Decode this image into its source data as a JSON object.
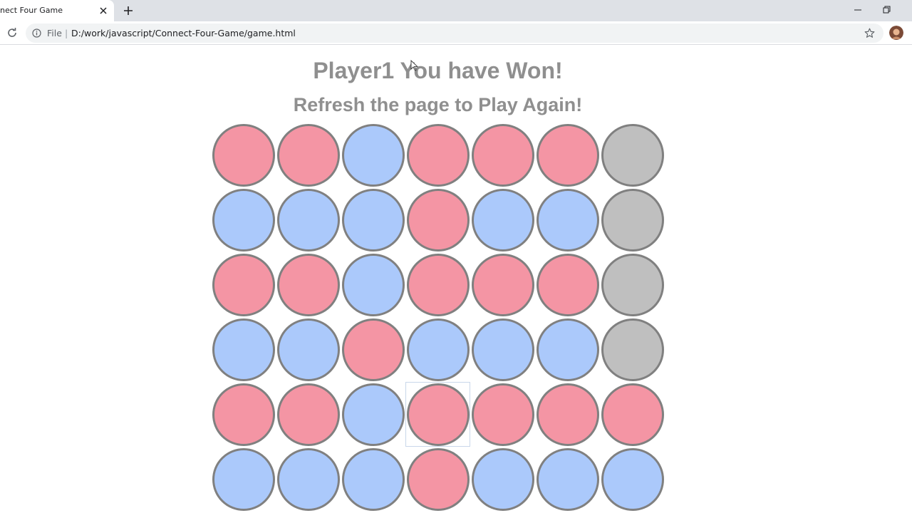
{
  "browser": {
    "tab_title": "nect Four Game",
    "address_scheme": "File",
    "address_separator": "|",
    "address_url": "D:/work/javascript/Connect-Four-Game/game.html"
  },
  "game": {
    "status_text": "Player1 You have Won!",
    "hint_text": "Refresh the page to Play Again!",
    "colors": {
      "player1": "#f495a4",
      "player2": "#abc9fb",
      "empty": "#bfbfbf",
      "border": "#808080"
    },
    "hovered_cell": {
      "row": 4,
      "col": 3
    },
    "board": [
      [
        "player1",
        "player1",
        "player2",
        "player1",
        "player1",
        "player1",
        "empty"
      ],
      [
        "player2",
        "player2",
        "player2",
        "player1",
        "player2",
        "player2",
        "empty"
      ],
      [
        "player1",
        "player1",
        "player2",
        "player1",
        "player1",
        "player1",
        "empty"
      ],
      [
        "player2",
        "player2",
        "player1",
        "player2",
        "player2",
        "player2",
        "empty"
      ],
      [
        "player1",
        "player1",
        "player2",
        "player1",
        "player1",
        "player1",
        "player1"
      ],
      [
        "player2",
        "player2",
        "player2",
        "player1",
        "player2",
        "player2",
        "player2"
      ]
    ]
  }
}
